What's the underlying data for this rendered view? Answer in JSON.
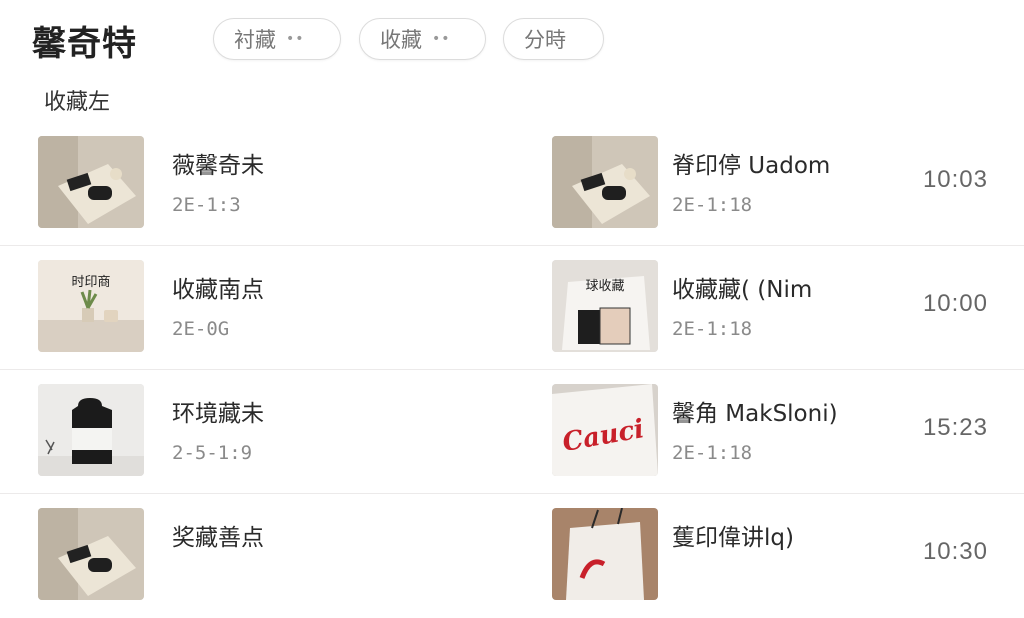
{
  "app": {
    "title": "馨奇特"
  },
  "filters": [
    {
      "label": "衬藏",
      "dots": "••"
    },
    {
      "label": "收藏",
      "dots": "••"
    },
    {
      "label": "分時",
      "dots": ""
    }
  ],
  "section": {
    "label": "收藏左"
  },
  "rows": [
    {
      "left": {
        "title": "薇馨奇未",
        "sub": "2E-1:3",
        "thumb": "bag-icon"
      },
      "right": {
        "title": "脊印停 Uadom",
        "sub": "2E-1:18",
        "time": "10:03",
        "thumb": "bag-icon"
      }
    },
    {
      "left": {
        "title": "收藏南点",
        "sub": "2E-0G",
        "thumb_text": "时印商",
        "thumb": "shelf-plant-icon"
      },
      "right": {
        "title": "收藏藏( (Nim",
        "sub": "2E-1:18",
        "time": "10:00",
        "thumb_text": "球收藏",
        "thumb": "tote-bag-icon"
      }
    },
    {
      "left": {
        "title": "环境藏未",
        "sub": "2-5-1:9",
        "thumb": "vase-icon"
      },
      "right": {
        "title": "馨角 MakSloni)",
        "sub": "2E-1:18",
        "time": "15:23",
        "thumb_text": "Cauci",
        "thumb": "red-script-cloth-icon"
      }
    },
    {
      "left": {
        "title": "奖藏善点",
        "sub": "",
        "thumb": "bag-icon"
      },
      "right": {
        "title": "蒦印偉讲lq)",
        "sub": "",
        "time": "10:30",
        "thumb": "red-script-bag-icon"
      }
    }
  ],
  "colors": {
    "background": "#ffffff",
    "divider": "#eceaea",
    "chip_border": "#dcdcdc",
    "accent_red": "#c8202a"
  }
}
